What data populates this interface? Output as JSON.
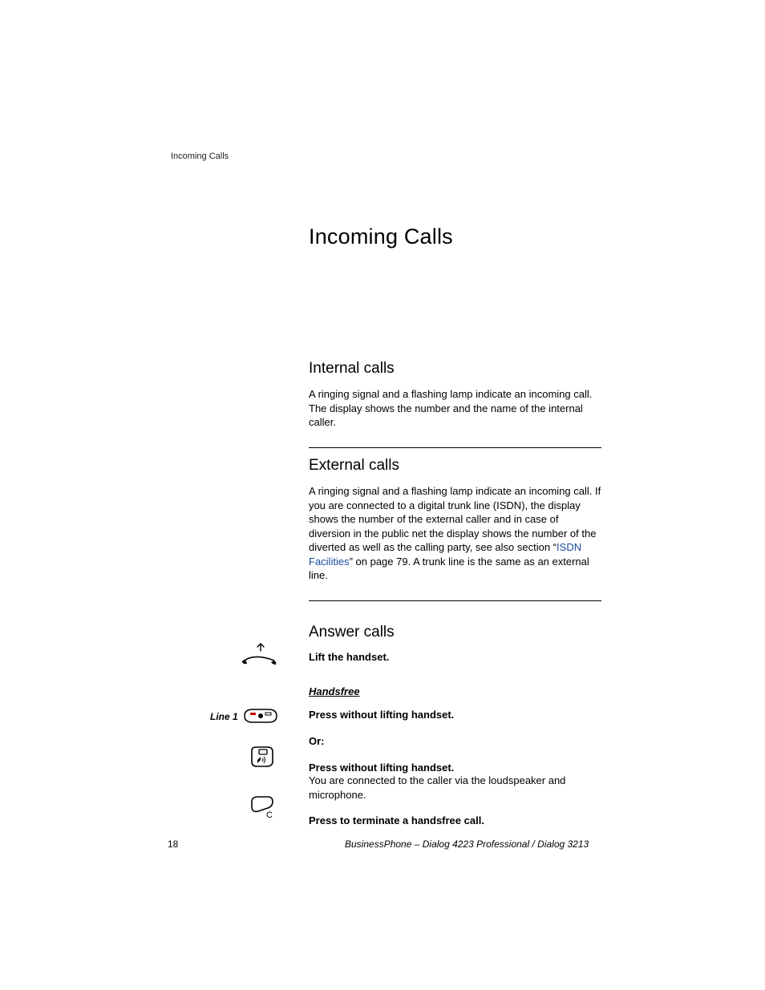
{
  "header": {
    "running": "Incoming Calls"
  },
  "title": "Incoming Calls",
  "sections": {
    "internal": {
      "heading": "Internal calls",
      "body": "A ringing signal and a flashing lamp indicate an incoming call. The display shows the number and the name of the internal caller."
    },
    "external": {
      "heading": "External calls",
      "body_pre": "A ringing signal and a flashing lamp indicate an incoming call. If you are connected to a digital trunk line (ISDN), the display shows the number of the external caller and in case of diversion in the public net the display shows the number of the diverted as well as the calling party, see also section “",
      "link": "ISDN Facilities",
      "body_post": "” on page 79. A trunk line is the same as an external line."
    },
    "answer": {
      "heading": "Answer calls",
      "lift": "Lift the handset.",
      "handsfree_sub": "Handsfree",
      "line1_label": "Line 1",
      "press1": "Press without lifting handset.",
      "or": "Or:",
      "press2": "Press without lifting handset.",
      "press2_body": "You are connected to the caller via the loudspeaker and microphone.",
      "terminate": "Press to terminate a handsfree call."
    }
  },
  "footer": {
    "page": "18",
    "line": "BusinessPhone – Dialog 4223 Professional / Dialog 3213"
  }
}
